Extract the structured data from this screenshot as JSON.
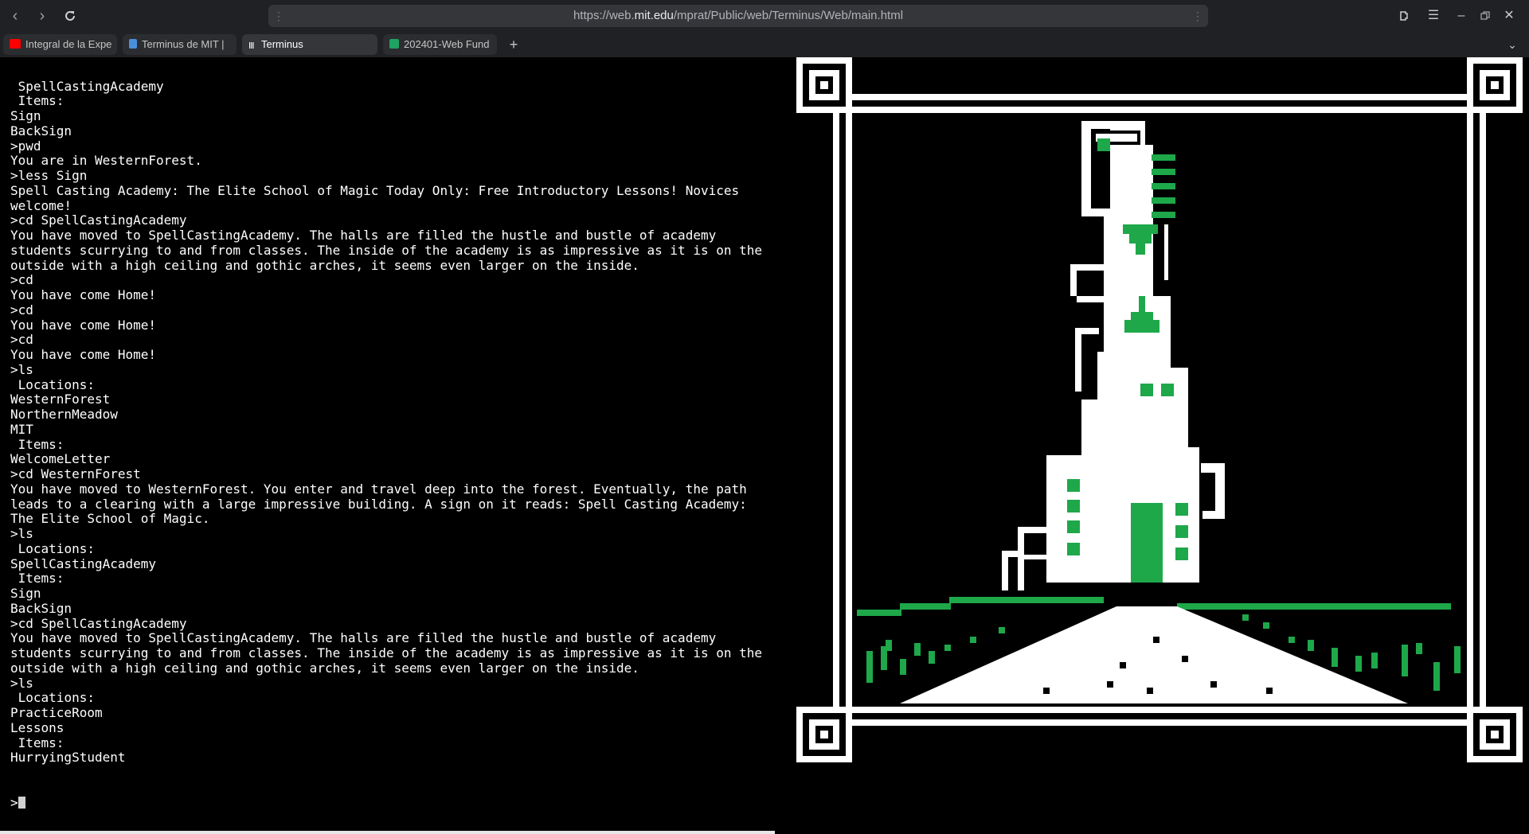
{
  "browser": {
    "url_prefix": "https://web.",
    "url_domain": "mit.edu",
    "url_path": "/mprat/Public/web/Terminus/Web/main.html",
    "tabs": [
      {
        "label": "Integral de la Expe",
        "icon": "youtube-icon",
        "color": "#ff0000"
      },
      {
        "label": "Terminus de MIT |",
        "icon": "site-icon",
        "color": "#4a90d9"
      },
      {
        "label": "Terminus",
        "icon": "terminus-icon",
        "color": "#ffffff"
      },
      {
        "label": "202401-Web Fund",
        "icon": "sheets-icon",
        "color": "#1ea362"
      }
    ],
    "new_tab_label": "+",
    "tab_list_label": "⌄"
  },
  "terminal": {
    "lines": [
      " SpellCastingAcademy",
      " Items:",
      "Sign",
      "BackSign",
      ">pwd",
      "You are in WesternForest.",
      ">less Sign",
      "Spell Casting Academy: The Elite School of Magic Today Only: Free Introductory Lessons! Novices welcome!",
      ">cd SpellCastingAcademy",
      "You have moved to SpellCastingAcademy. The halls are filled the hustle and bustle of academy students scurrying to and from classes. The inside of the academy is as impressive as it is on the outside with a high ceiling and gothic arches, it seems even larger on the inside.",
      ">cd",
      "You have come Home!",
      ">cd",
      "You have come Home!",
      ">cd",
      "You have come Home!",
      ">ls",
      " Locations:",
      "WesternForest",
      "NorthernMeadow",
      "MIT",
      " Items:",
      "WelcomeLetter",
      ">cd WesternForest",
      "You have moved to WesternForest. You enter and travel deep into the forest. Eventually, the path leads to a clearing with a large impressive building. A sign on it reads: Spell Casting Academy: The Elite School of Magic.",
      ">ls",
      " Locations:",
      "SpellCastingAcademy",
      " Items:",
      "Sign",
      "BackSign",
      ">cd SpellCastingAcademy",
      "You have moved to SpellCastingAcademy. The halls are filled the hustle and bustle of academy students scurrying to and from classes. The inside of the academy is as impressive as it is on the outside with a high ceiling and gothic arches, it seems even larger on the inside.",
      ">ls",
      " Locations:",
      "PracticeRoom",
      "Lessons",
      " Items:",
      "HurryingStudent"
    ],
    "prompt": ">",
    "input_value": ""
  },
  "colors": {
    "chrome_bg": "#202124",
    "terminal_bg": "#000000",
    "terminal_fg": "#ffffff",
    "art_green": "#1ea84a"
  }
}
